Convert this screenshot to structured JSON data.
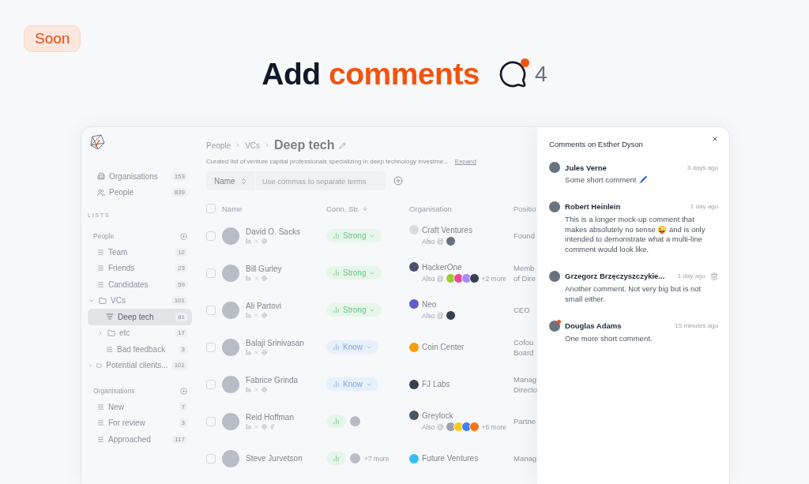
{
  "badge": "Soon",
  "heading": {
    "lead": "Add",
    "accent": "comments",
    "count": "4",
    "unread": true
  },
  "app": {
    "sidebar": {
      "nav": [
        {
          "kind": "organisations",
          "label": "Organisations",
          "count": "153"
        },
        {
          "kind": "people",
          "label": "People",
          "count": "839"
        }
      ],
      "lists_heading": "LISTS",
      "groups": [
        {
          "title": "People",
          "items": [
            {
              "kind": "list",
              "label": "Team",
              "count": "12",
              "selected": false
            },
            {
              "kind": "list",
              "label": "Friends",
              "count": "23",
              "selected": false
            },
            {
              "kind": "list",
              "label": "Candidates",
              "count": "59",
              "selected": false
            },
            {
              "kind": "folder",
              "label": "VCs",
              "count": "101",
              "selected": false,
              "expanded": true,
              "children": [
                {
                  "kind": "smartlist",
                  "label": "Deep tech",
                  "count": "81",
                  "selected": true
                },
                {
                  "kind": "folder",
                  "label": "etc",
                  "count": "17",
                  "selected": false,
                  "expanded": false
                },
                {
                  "kind": "list",
                  "label": "Bad feedback",
                  "count": "3",
                  "selected": false
                }
              ]
            },
            {
              "kind": "folder",
              "label": "Potential clients...",
              "count": "101",
              "selected": false,
              "expanded": false
            }
          ]
        },
        {
          "title": "Organisations",
          "items": [
            {
              "kind": "list",
              "label": "New",
              "count": "7",
              "selected": false
            },
            {
              "kind": "list",
              "label": "For review",
              "count": "3",
              "selected": false
            },
            {
              "kind": "list",
              "label": "Approached",
              "count": "117",
              "selected": false
            }
          ]
        }
      ]
    },
    "breadcrumb": [
      "People",
      "VCs"
    ],
    "title": "Deep tech",
    "description": "Curated list of venture capital professionals specializing in deep technology investme...",
    "expand": "Expand",
    "filter": {
      "field": "Name",
      "placeholder": "Use commas to separate terms"
    },
    "all_checked": false,
    "columns": [
      "Name",
      "Conn. Str.",
      "Organisation",
      "Positio"
    ],
    "rows": [
      {
        "checked": false,
        "name": "David O. Sacks",
        "socials": [
          {
            "kind": "linkedin"
          },
          {
            "kind": "x"
          },
          {
            "kind": "web"
          }
        ],
        "conn": {
          "kind": "strong",
          "label": "Strong"
        },
        "org": {
          "name": "Craft Ventures",
          "color": "#d9dbe0",
          "also": {
            "label": "Also @",
            "logos": [
              {
                "color": "#6b7280"
              }
            ]
          }
        },
        "position": [
          "Found"
        ]
      },
      {
        "checked": false,
        "name": "Bill Gurley",
        "socials": [
          {
            "kind": "linkedin"
          },
          {
            "kind": "x"
          },
          {
            "kind": "web"
          }
        ],
        "conn": {
          "kind": "strong",
          "label": "Strong"
        },
        "org": {
          "name": "HackerOne",
          "color": "#4b4f6b",
          "also": {
            "label": "Also @",
            "logos": [
              {
                "color": "#9acd32"
              },
              {
                "color": "#ec4899"
              },
              {
                "color": "#a78bfa"
              },
              {
                "color": "#374151"
              }
            ],
            "more": "+2 more"
          }
        },
        "position": [
          "Memb",
          "of Dire"
        ]
      },
      {
        "checked": false,
        "name": "Ali Partovi",
        "socials": [
          {
            "kind": "linkedin"
          },
          {
            "kind": "x"
          },
          {
            "kind": "web"
          }
        ],
        "conn": {
          "kind": "strong",
          "label": "Strong"
        },
        "org": {
          "name": "Neo",
          "color": "#5b5fc7",
          "also": {
            "label": "Also @",
            "logos": [
              {
                "color": "#374151"
              }
            ]
          }
        },
        "position": [
          "CEO"
        ]
      },
      {
        "checked": false,
        "name": "Balaji Srinivasan",
        "socials": [
          {
            "kind": "linkedin"
          },
          {
            "kind": "x"
          },
          {
            "kind": "web"
          }
        ],
        "conn": {
          "kind": "know",
          "label": "Know"
        },
        "org": {
          "name": "Coin Center",
          "color": "#f59e0b"
        },
        "position": [
          "Cofou",
          "Board"
        ]
      },
      {
        "checked": false,
        "name": "Fabrice Grinda",
        "socials": [
          {
            "kind": "linkedin"
          },
          {
            "kind": "x"
          },
          {
            "kind": "web"
          }
        ],
        "conn": {
          "kind": "know",
          "label": "Know"
        },
        "org": {
          "name": "FJ Labs",
          "color": "#374151"
        },
        "position": [
          "Manag",
          "Directo"
        ]
      },
      {
        "checked": false,
        "name": "Reid Hoffman",
        "socials": [
          {
            "kind": "linkedin"
          },
          {
            "kind": "x"
          },
          {
            "kind": "web"
          },
          {
            "kind": "facebook"
          }
        ],
        "conn": {
          "kind": "intro"
        },
        "org": {
          "name": "Greylock",
          "color": "#4b5563",
          "also": {
            "label": "Also @",
            "logos": [
              {
                "color": "#9ca3af"
              },
              {
                "color": "#facc15"
              },
              {
                "color": "#3b82f6"
              },
              {
                "color": "#f97316"
              }
            ],
            "more": "+6 more"
          }
        },
        "position": [
          "Partne"
        ]
      },
      {
        "checked": false,
        "name": "Steve Jurvetson",
        "socials": [],
        "conn": {
          "kind": "intro",
          "more": "+7 more"
        },
        "org": {
          "name": "Future Ventures",
          "color": "#38bdf8"
        },
        "position": [
          "Manag"
        ]
      }
    ]
  },
  "comments": {
    "title": "Comments on Esther Dyson",
    "items": [
      {
        "author": "Jules Verne",
        "time": "3 days ago",
        "text": "Some short comment 🖊️",
        "unread": false,
        "deletable": false
      },
      {
        "author": "Robert Heinlein",
        "time": "1 day ago",
        "text": "This is a longer mock-up comment that makes absolutely no sense 😜 and is only intended to demonstrate what a multi-line comment would look like.",
        "unread": false,
        "deletable": false
      },
      {
        "author": "Grzegorz Brzęczyszczykie...",
        "time": "1 day ago",
        "text": "Another comment. Not very big but is not small either.",
        "unread": false,
        "deletable": true
      },
      {
        "author": "Douglas Adams",
        "time": "15 minutes ago",
        "text": "One more short comment.",
        "unread": true,
        "deletable": false
      }
    ]
  }
}
